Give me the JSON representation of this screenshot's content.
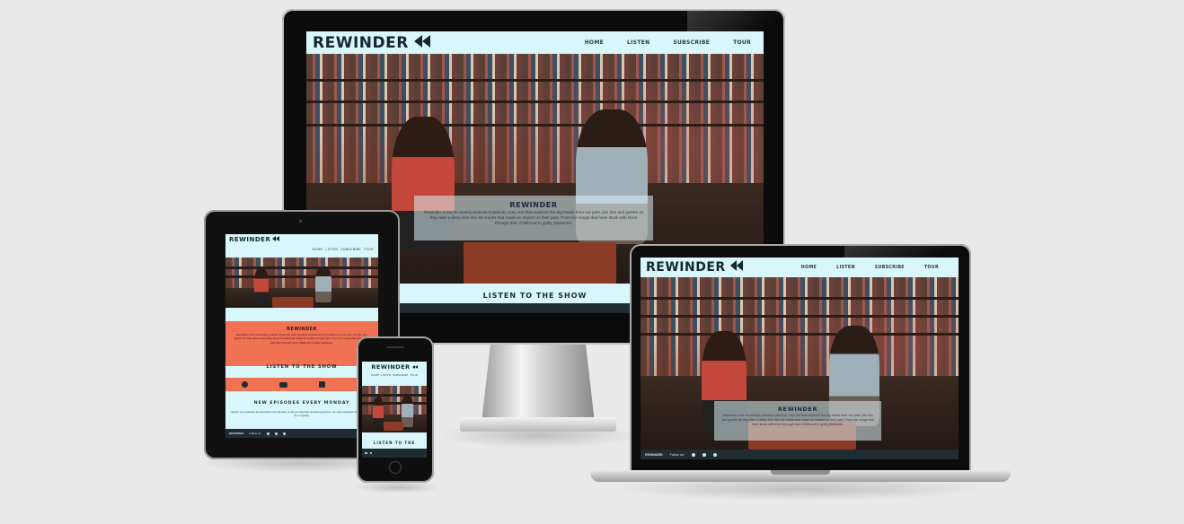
{
  "site": {
    "brand": "REWINDER",
    "nav": [
      "HOME",
      "LISTEN",
      "SUBSCRIBE",
      "TOUR"
    ],
    "hero_title": "REWINDER",
    "hero_text": "Rewinder is the hit weekly podcast hosted by Joey Joe that explores the big tracks from our past, join him and guests as they take a deep dive into the tracks that made an impact on their past. From the songs that have stuck with them through their childhood to guilty pleasures.",
    "listen_title": "LISTEN TO THE SHOW",
    "episodes_title": "NEW EPISODES EVERY MONDAY",
    "episodes_text": "Search new episodes are launched every Monday on all your favourite streaming services, our latest episodes below and follow us on Spotify.",
    "listen_short": "LISTEN TO THE",
    "footer_brand": "REWINDER",
    "footer_follow": "Follow us:"
  },
  "colors": {
    "page_bg": "#e9e9e9",
    "site_bg": "#d9f6fb",
    "brand_text": "#15262e",
    "accent": "#f07153",
    "footer_bg": "#1f2d33"
  },
  "icons": [
    "spotify-icon",
    "youtube-icon",
    "twitch-icon",
    "facebook-icon",
    "twitter-icon",
    "tiktok-icon",
    "rewind-icon"
  ]
}
